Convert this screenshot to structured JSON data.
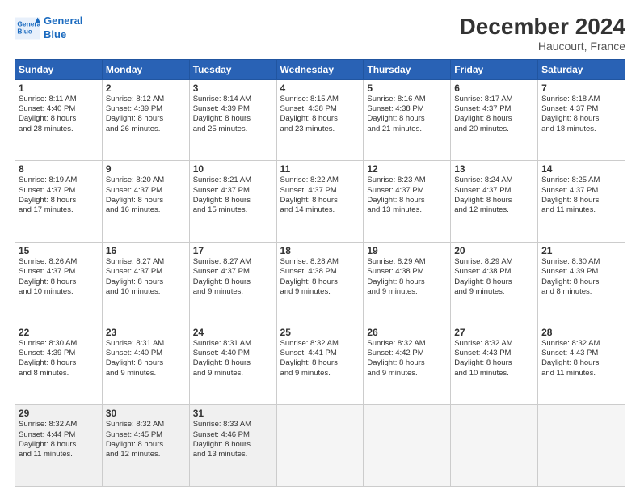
{
  "header": {
    "logo_line1": "General",
    "logo_line2": "Blue",
    "title": "December 2024",
    "subtitle": "Haucourt, France"
  },
  "days_of_week": [
    "Sunday",
    "Monday",
    "Tuesday",
    "Wednesday",
    "Thursday",
    "Friday",
    "Saturday"
  ],
  "weeks": [
    [
      {
        "day": "1",
        "lines": [
          "Sunrise: 8:11 AM",
          "Sunset: 4:40 PM",
          "Daylight: 8 hours",
          "and 28 minutes."
        ]
      },
      {
        "day": "2",
        "lines": [
          "Sunrise: 8:12 AM",
          "Sunset: 4:39 PM",
          "Daylight: 8 hours",
          "and 26 minutes."
        ]
      },
      {
        "day": "3",
        "lines": [
          "Sunrise: 8:14 AM",
          "Sunset: 4:39 PM",
          "Daylight: 8 hours",
          "and 25 minutes."
        ]
      },
      {
        "day": "4",
        "lines": [
          "Sunrise: 8:15 AM",
          "Sunset: 4:38 PM",
          "Daylight: 8 hours",
          "and 23 minutes."
        ]
      },
      {
        "day": "5",
        "lines": [
          "Sunrise: 8:16 AM",
          "Sunset: 4:38 PM",
          "Daylight: 8 hours",
          "and 21 minutes."
        ]
      },
      {
        "day": "6",
        "lines": [
          "Sunrise: 8:17 AM",
          "Sunset: 4:37 PM",
          "Daylight: 8 hours",
          "and 20 minutes."
        ]
      },
      {
        "day": "7",
        "lines": [
          "Sunrise: 8:18 AM",
          "Sunset: 4:37 PM",
          "Daylight: 8 hours",
          "and 18 minutes."
        ]
      }
    ],
    [
      {
        "day": "8",
        "lines": [
          "Sunrise: 8:19 AM",
          "Sunset: 4:37 PM",
          "Daylight: 8 hours",
          "and 17 minutes."
        ]
      },
      {
        "day": "9",
        "lines": [
          "Sunrise: 8:20 AM",
          "Sunset: 4:37 PM",
          "Daylight: 8 hours",
          "and 16 minutes."
        ]
      },
      {
        "day": "10",
        "lines": [
          "Sunrise: 8:21 AM",
          "Sunset: 4:37 PM",
          "Daylight: 8 hours",
          "and 15 minutes."
        ]
      },
      {
        "day": "11",
        "lines": [
          "Sunrise: 8:22 AM",
          "Sunset: 4:37 PM",
          "Daylight: 8 hours",
          "and 14 minutes."
        ]
      },
      {
        "day": "12",
        "lines": [
          "Sunrise: 8:23 AM",
          "Sunset: 4:37 PM",
          "Daylight: 8 hours",
          "and 13 minutes."
        ]
      },
      {
        "day": "13",
        "lines": [
          "Sunrise: 8:24 AM",
          "Sunset: 4:37 PM",
          "Daylight: 8 hours",
          "and 12 minutes."
        ]
      },
      {
        "day": "14",
        "lines": [
          "Sunrise: 8:25 AM",
          "Sunset: 4:37 PM",
          "Daylight: 8 hours",
          "and 11 minutes."
        ]
      }
    ],
    [
      {
        "day": "15",
        "lines": [
          "Sunrise: 8:26 AM",
          "Sunset: 4:37 PM",
          "Daylight: 8 hours",
          "and 10 minutes."
        ]
      },
      {
        "day": "16",
        "lines": [
          "Sunrise: 8:27 AM",
          "Sunset: 4:37 PM",
          "Daylight: 8 hours",
          "and 10 minutes."
        ]
      },
      {
        "day": "17",
        "lines": [
          "Sunrise: 8:27 AM",
          "Sunset: 4:37 PM",
          "Daylight: 8 hours",
          "and 9 minutes."
        ]
      },
      {
        "day": "18",
        "lines": [
          "Sunrise: 8:28 AM",
          "Sunset: 4:38 PM",
          "Daylight: 8 hours",
          "and 9 minutes."
        ]
      },
      {
        "day": "19",
        "lines": [
          "Sunrise: 8:29 AM",
          "Sunset: 4:38 PM",
          "Daylight: 8 hours",
          "and 9 minutes."
        ]
      },
      {
        "day": "20",
        "lines": [
          "Sunrise: 8:29 AM",
          "Sunset: 4:38 PM",
          "Daylight: 8 hours",
          "and 9 minutes."
        ]
      },
      {
        "day": "21",
        "lines": [
          "Sunrise: 8:30 AM",
          "Sunset: 4:39 PM",
          "Daylight: 8 hours",
          "and 8 minutes."
        ]
      }
    ],
    [
      {
        "day": "22",
        "lines": [
          "Sunrise: 8:30 AM",
          "Sunset: 4:39 PM",
          "Daylight: 8 hours",
          "and 8 minutes."
        ]
      },
      {
        "day": "23",
        "lines": [
          "Sunrise: 8:31 AM",
          "Sunset: 4:40 PM",
          "Daylight: 8 hours",
          "and 9 minutes."
        ]
      },
      {
        "day": "24",
        "lines": [
          "Sunrise: 8:31 AM",
          "Sunset: 4:40 PM",
          "Daylight: 8 hours",
          "and 9 minutes."
        ]
      },
      {
        "day": "25",
        "lines": [
          "Sunrise: 8:32 AM",
          "Sunset: 4:41 PM",
          "Daylight: 8 hours",
          "and 9 minutes."
        ]
      },
      {
        "day": "26",
        "lines": [
          "Sunrise: 8:32 AM",
          "Sunset: 4:42 PM",
          "Daylight: 8 hours",
          "and 9 minutes."
        ]
      },
      {
        "day": "27",
        "lines": [
          "Sunrise: 8:32 AM",
          "Sunset: 4:43 PM",
          "Daylight: 8 hours",
          "and 10 minutes."
        ]
      },
      {
        "day": "28",
        "lines": [
          "Sunrise: 8:32 AM",
          "Sunset: 4:43 PM",
          "Daylight: 8 hours",
          "and 11 minutes."
        ]
      }
    ],
    [
      {
        "day": "29",
        "lines": [
          "Sunrise: 8:32 AM",
          "Sunset: 4:44 PM",
          "Daylight: 8 hours",
          "and 11 minutes."
        ]
      },
      {
        "day": "30",
        "lines": [
          "Sunrise: 8:32 AM",
          "Sunset: 4:45 PM",
          "Daylight: 8 hours",
          "and 12 minutes."
        ]
      },
      {
        "day": "31",
        "lines": [
          "Sunrise: 8:33 AM",
          "Sunset: 4:46 PM",
          "Daylight: 8 hours",
          "and 13 minutes."
        ]
      },
      {
        "day": "",
        "lines": []
      },
      {
        "day": "",
        "lines": []
      },
      {
        "day": "",
        "lines": []
      },
      {
        "day": "",
        "lines": []
      }
    ]
  ]
}
